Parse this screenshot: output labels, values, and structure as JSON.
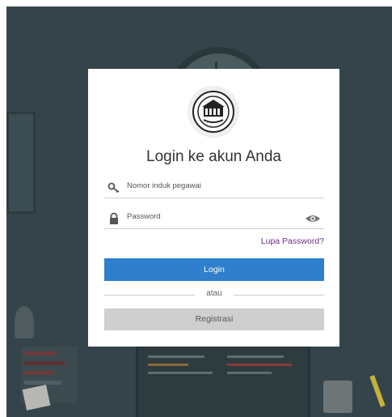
{
  "card": {
    "title": "Login ke akun Anda",
    "logo": "institution-seal-logo"
  },
  "fields": {
    "employee_id": {
      "placeholder": "Nomor induk pegawai",
      "icon": "key-icon"
    },
    "password": {
      "placeholder": "Password",
      "icon": "lock-icon",
      "toggle_icon": "eye-icon"
    }
  },
  "links": {
    "forgot_password": "Lupa Password?"
  },
  "buttons": {
    "login": "Login",
    "register": "Registrasi"
  },
  "divider": {
    "text": "atau"
  },
  "colors": {
    "primary": "#2f7fcc",
    "link": "#6a2c8c",
    "secondary_button": "#cfcfcf",
    "background": "#34444a"
  }
}
